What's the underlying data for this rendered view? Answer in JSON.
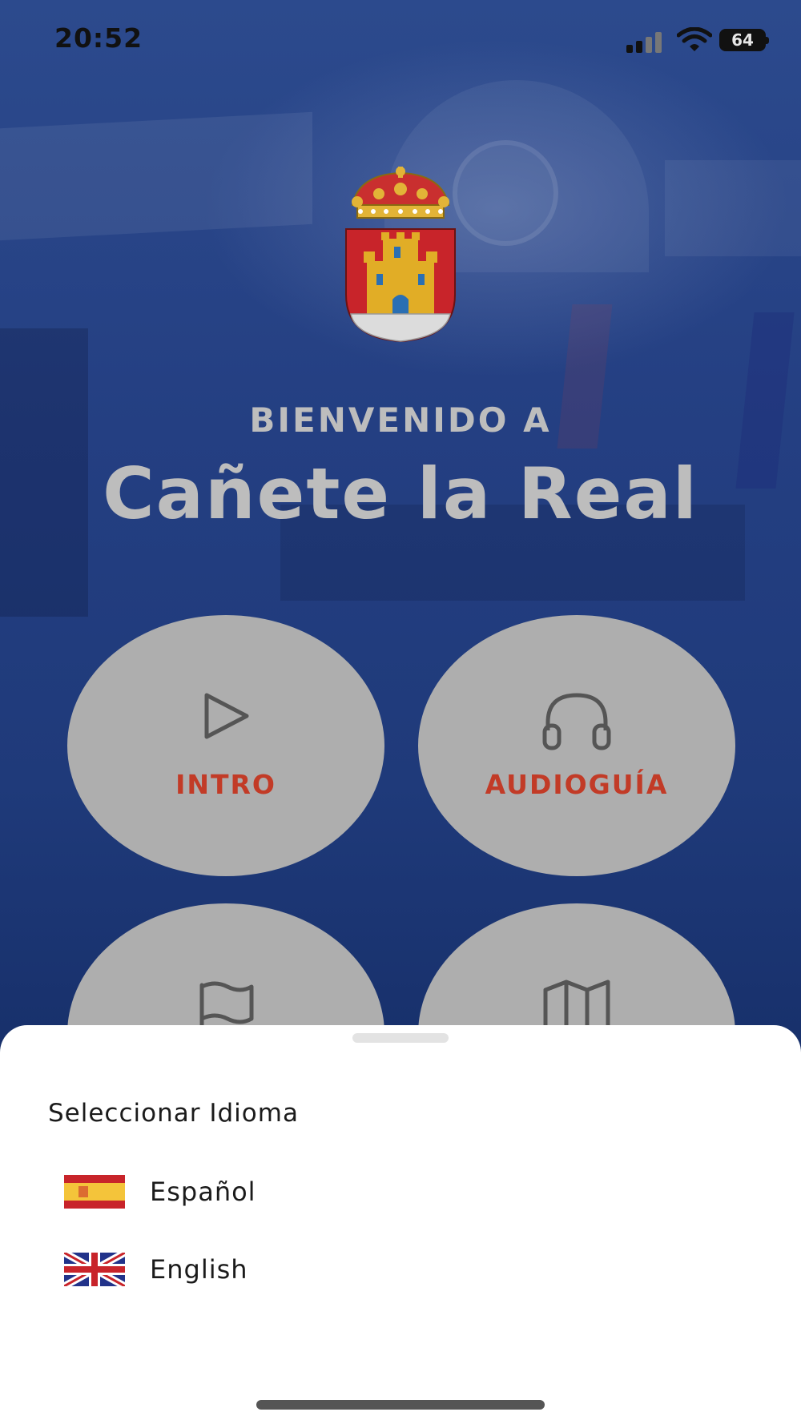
{
  "status_bar": {
    "time": "20:52",
    "battery": "64"
  },
  "header": {
    "welcome": "BIENVENIDO A",
    "town_name": "Cañete la Real"
  },
  "menu": [
    {
      "label": "INTRO",
      "icon": "play-icon"
    },
    {
      "label": "AUDIOGUÍA",
      "icon": "headphones-icon"
    },
    {
      "label": "",
      "icon": "flag-icon"
    },
    {
      "label": "",
      "icon": "map-icon"
    }
  ],
  "language_sheet": {
    "title": "Seleccionar Idioma",
    "options": [
      {
        "label": "Español",
        "flag": "spain-flag-icon"
      },
      {
        "label": "English",
        "flag": "uk-flag-icon"
      }
    ]
  },
  "colors": {
    "background": "#1e3a80",
    "button": "#aeaeae",
    "accent": "#c23b27",
    "sheet": "#ffffff"
  }
}
